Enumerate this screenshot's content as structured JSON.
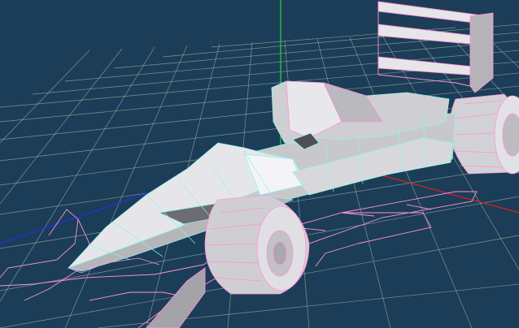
{
  "viewport": {
    "background": "#1c3d57",
    "grid_color": "#c9dcc0",
    "axes": {
      "x_color": "#e0201e",
      "y_color": "#20d93a",
      "z_color": "#2030e8"
    },
    "model": {
      "name": "formula-1-race-car-wireframe",
      "fill_color": "#d6d6d8",
      "shade_color": "#a9a9ad",
      "dark_color": "#7e7e84",
      "edge_color_pink": "#ff8fd8",
      "edge_color_cyan": "#8ff5e6"
    }
  }
}
